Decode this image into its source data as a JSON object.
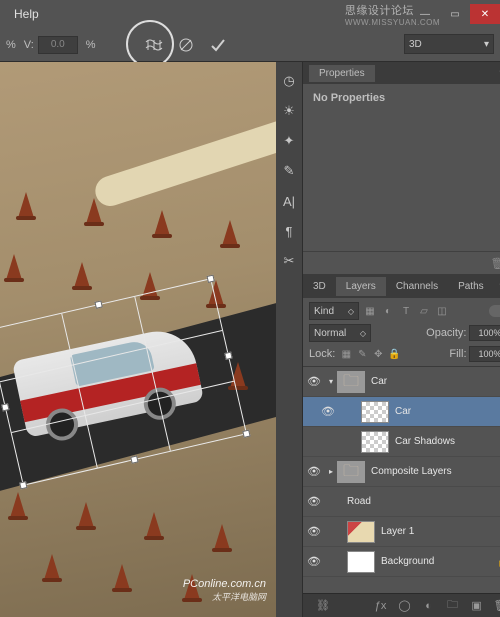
{
  "menubar": {
    "help": "Help"
  },
  "watermark_top": {
    "line1": "思缘设计论坛",
    "line2": "WWW.MISSYUAN.COM"
  },
  "options": {
    "v_label": "V:",
    "v_value": "0.0",
    "pct1": "%",
    "pct2": "%",
    "mode": "3D"
  },
  "vstrip_icons": [
    "adjust",
    "swatches",
    "brush",
    "type",
    "paragraph",
    "tool"
  ],
  "properties": {
    "tab": "Properties",
    "text": "No Properties"
  },
  "layers_panel": {
    "tabs": [
      "3D",
      "Layers",
      "Channels",
      "Paths"
    ],
    "kind_label": "Kind",
    "blend": "Normal",
    "opacity_label": "Opacity:",
    "opacity": "100%",
    "lock_label": "Lock:",
    "fill_label": "Fill:",
    "fill": "100%"
  },
  "layers": {
    "group": "Car",
    "car": "Car",
    "shadows": "Car Shadows",
    "composite": "Composite Layers",
    "road": "Road",
    "layer1": "Layer 1",
    "background": "Background"
  },
  "watermark_bottom": {
    "line1": "PConline.com.cn",
    "line2": "太平洋电脑网"
  }
}
